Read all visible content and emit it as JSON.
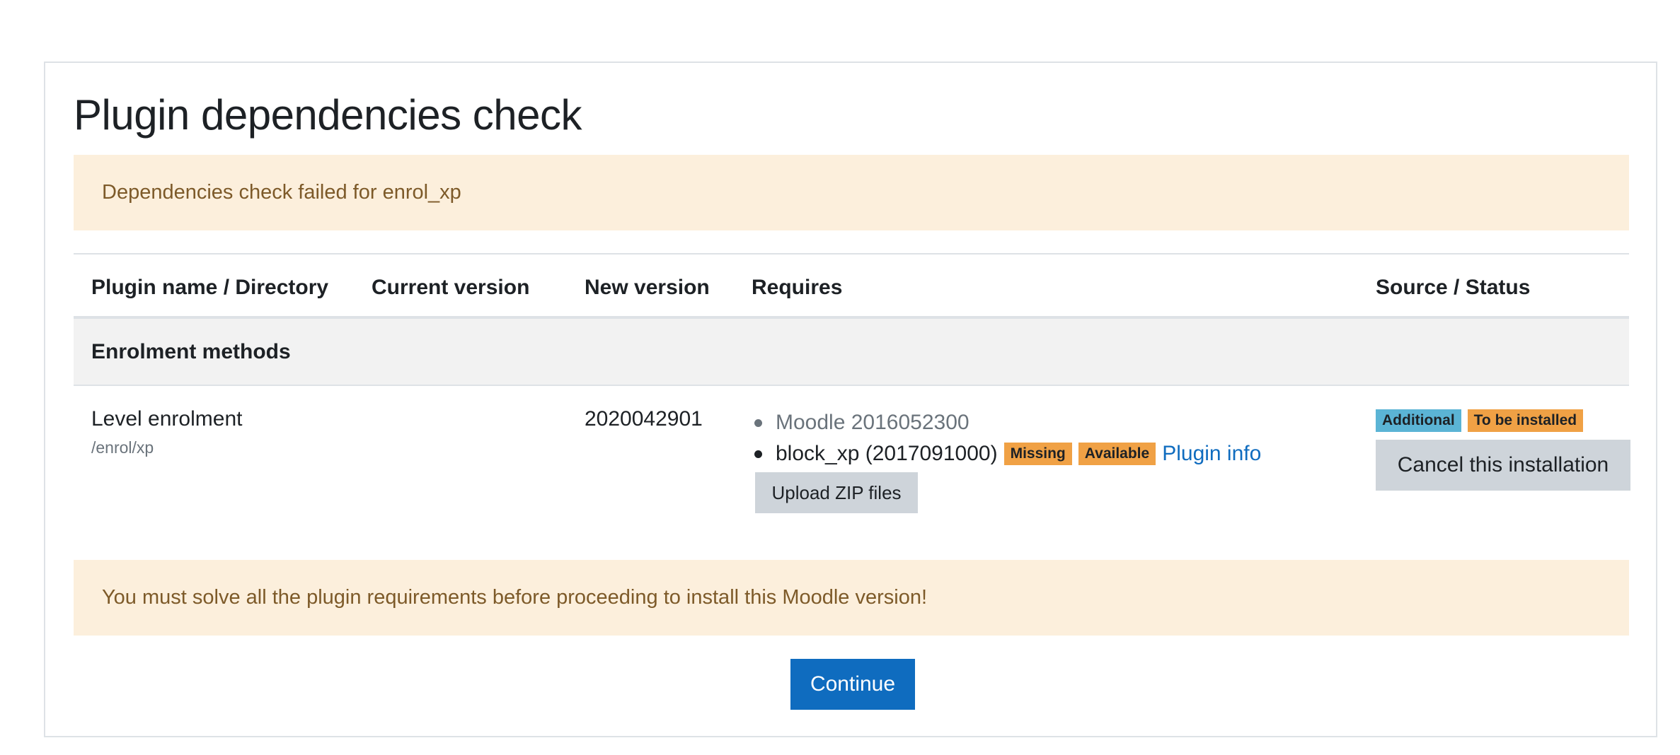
{
  "page": {
    "title": "Plugin dependencies check"
  },
  "alerts": {
    "top": "Dependencies check failed for enrol_xp",
    "bottom": "You must solve all the plugin requirements before proceeding to install this Moodle version!"
  },
  "table": {
    "headers": {
      "name": "Plugin name / Directory",
      "current": "Current version",
      "new": "New version",
      "requires": "Requires",
      "status": "Source / Status"
    },
    "group": "Enrolment methods",
    "row": {
      "name": "Level enrolment",
      "directory": "/enrol/xp",
      "current_version": "",
      "new_version": "2020042901",
      "requires": [
        {
          "text": "Moodle 2016052300"
        },
        {
          "text": "block_xp (2017091000)",
          "badges": [
            "Missing",
            "Available"
          ],
          "link": "Plugin info"
        }
      ],
      "upload_label": "Upload ZIP files",
      "status_badges": [
        "Additional",
        "To be installed"
      ],
      "cancel_label": "Cancel this installation"
    }
  },
  "actions": {
    "continue_label": "Continue"
  },
  "colors": {
    "primary": "#0f6cbf",
    "warning_badge": "#f0a145",
    "info_badge": "#5bb4d5",
    "alert_bg": "#fcefdc",
    "alert_text": "#7d5a29"
  }
}
